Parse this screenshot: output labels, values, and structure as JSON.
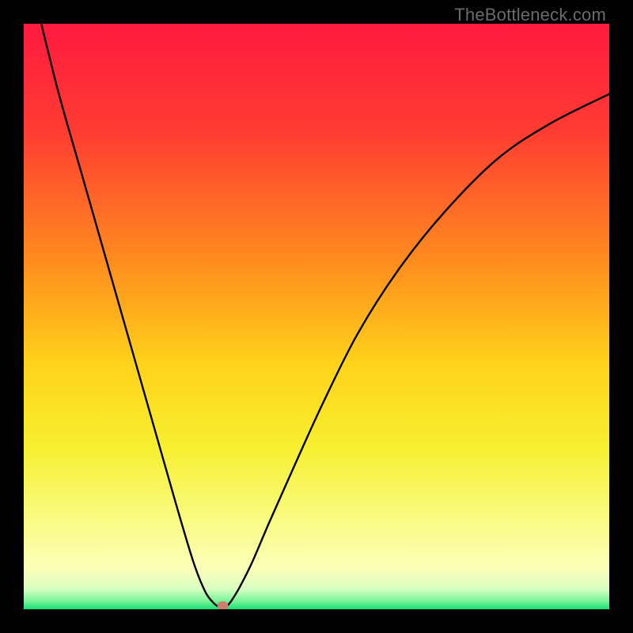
{
  "watermark": "TheBottleneck.com",
  "chart_data": {
    "type": "line",
    "title": "",
    "xlabel": "",
    "ylabel": "",
    "xlim": [
      0,
      100
    ],
    "ylim": [
      0,
      100
    ],
    "grid": false,
    "legend": false,
    "gradient_stops": [
      {
        "offset": 0.0,
        "color": "#ff1a3f"
      },
      {
        "offset": 0.18,
        "color": "#ff3b32"
      },
      {
        "offset": 0.4,
        "color": "#ff8a1f"
      },
      {
        "offset": 0.58,
        "color": "#ffd21a"
      },
      {
        "offset": 0.72,
        "color": "#f7ef2e"
      },
      {
        "offset": 0.85,
        "color": "#f9fb84"
      },
      {
        "offset": 0.93,
        "color": "#fcffb8"
      },
      {
        "offset": 0.965,
        "color": "#d9ffc0"
      },
      {
        "offset": 0.985,
        "color": "#7df59a"
      },
      {
        "offset": 1.0,
        "color": "#17e074"
      }
    ],
    "series": [
      {
        "name": "bottleneck-curve",
        "x": [
          3,
          6,
          10,
          14,
          18,
          22,
          26,
          29,
          31,
          32.5,
          33.5,
          34,
          34.5,
          35.5,
          37,
          39,
          42,
          46,
          51,
          57,
          64,
          72,
          81,
          90,
          100
        ],
        "y": [
          100,
          88,
          74,
          60,
          46,
          32,
          18,
          8,
          3,
          1,
          0.3,
          0,
          0.3,
          1.5,
          4,
          8,
          15,
          24,
          35,
          47,
          58,
          68,
          77,
          83,
          88
        ]
      }
    ],
    "marker": {
      "x": 34,
      "y": 0.6,
      "color": "#cf7d6e",
      "radius": 7
    }
  }
}
